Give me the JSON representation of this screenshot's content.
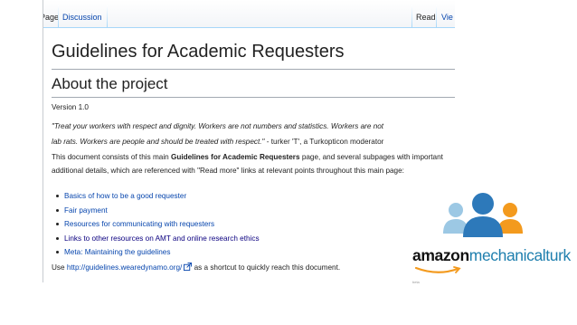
{
  "tabs": {
    "page": "Page",
    "discussion": "Discussion",
    "read": "Read",
    "view": "Vie"
  },
  "article": {
    "title": "Guidelines for Academic Requesters",
    "section_heading": "About the project",
    "version": "Version 1.0",
    "quote_line1": "\"Treat your workers with respect and dignity. Workers are not numbers and statistics. Workers are not",
    "quote_line2_italic": "lab rats. Workers are people and should be treated with respect.\"",
    "quote_attribution": " - turker 'T', a Turkopticon moderator",
    "para_before": "This document consists of this main ",
    "para_bold": "Guidelines for Academic Requesters",
    "para_after": " page, and several subpages with important additional details, which are referenced with \"Read more\" links at relevant points throughout this main page:",
    "links": [
      "Basics of how to be a good requester",
      "Fair payment",
      "Resources for communicating with requesters",
      "Links to other resources on AMT and online research ethics",
      "Meta: Maintaining the guidelines"
    ],
    "use_prefix": "Use ",
    "use_link": "http://guidelines.wearedynamo.org/",
    "use_suffix": " as a shortcut to quickly reach this document."
  },
  "logo": {
    "amazon": "amazon",
    "mechanical_turk": "mechanicalturk",
    "tiny": "beta"
  },
  "colors": {
    "link": "#0645ad",
    "visited_link": "#0b0080",
    "brand_blue": "#1f7fae",
    "brand_orange": "#f39a1e"
  }
}
